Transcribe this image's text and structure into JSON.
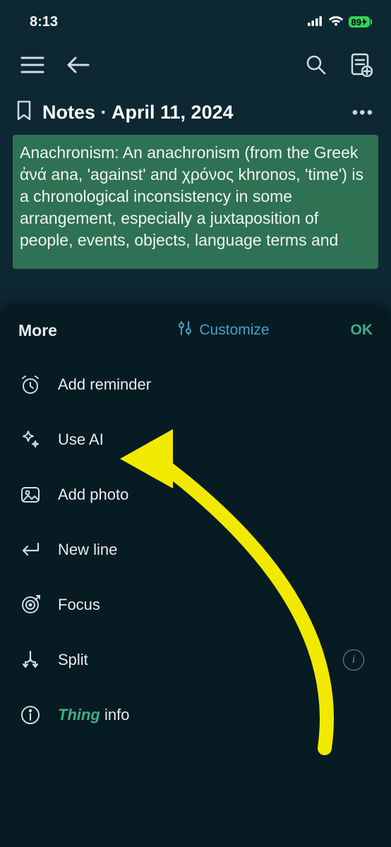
{
  "status": {
    "time": "8:13",
    "battery": "89"
  },
  "note": {
    "title": "Notes · April 11, 2024",
    "body": "Anachronism: An anachronism (from the Greek ἀνά ana, 'against' and χρόνος khronos, 'time') is a chronological inconsistency in some arrangement, especially a juxtaposition of people, events, objects, language terms and"
  },
  "sheet": {
    "title": "More",
    "customize": "Customize",
    "ok": "OK",
    "items": [
      {
        "label": "Add reminder"
      },
      {
        "label": "Use AI"
      },
      {
        "label": "Add photo"
      },
      {
        "label": "New line"
      },
      {
        "label": "Focus"
      },
      {
        "label": "Split"
      }
    ],
    "thing_italic": "Thing",
    "thing_rest": " info"
  }
}
